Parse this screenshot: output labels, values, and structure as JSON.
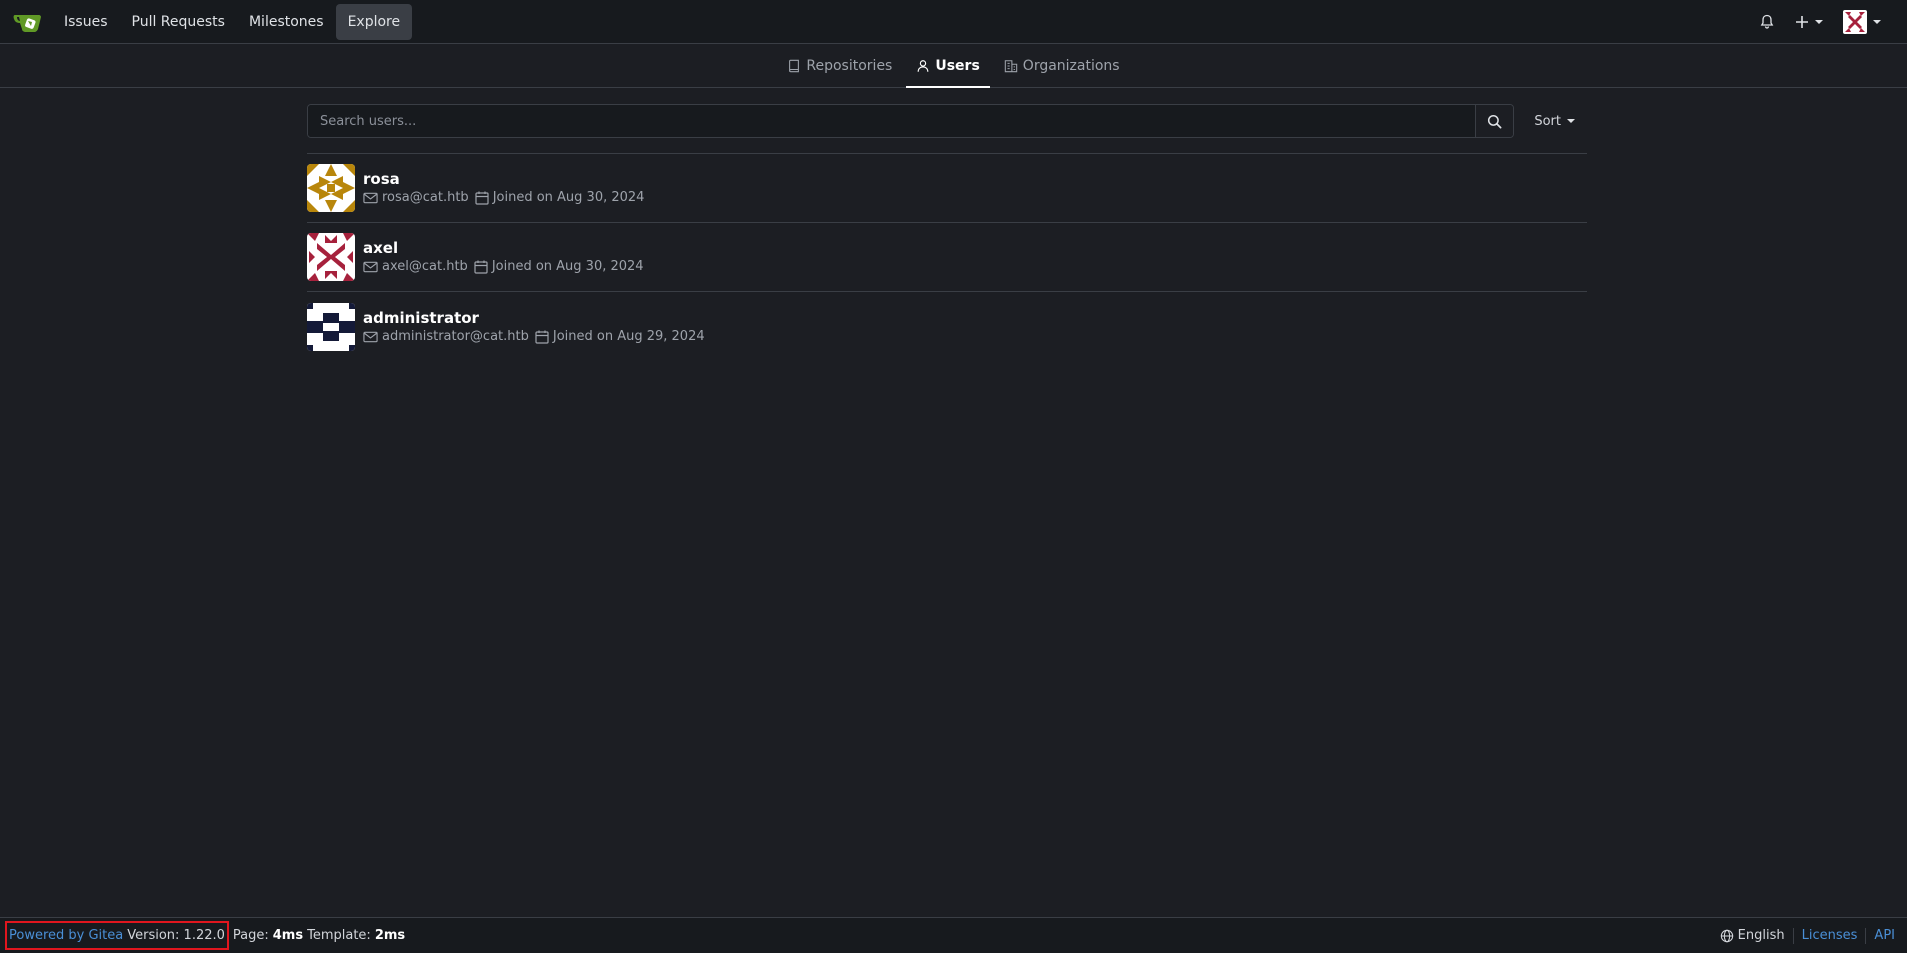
{
  "nav": {
    "items": [
      {
        "label": "Issues"
      },
      {
        "label": "Pull Requests"
      },
      {
        "label": "Milestones"
      },
      {
        "label": "Explore",
        "active": true
      }
    ],
    "icons": [
      "bell-icon",
      "plus-icon",
      "avatar"
    ]
  },
  "tabs": [
    {
      "label": "Repositories",
      "icon": "repo-icon"
    },
    {
      "label": "Users",
      "icon": "person-icon",
      "active": true
    },
    {
      "label": "Organizations",
      "icon": "organization-icon"
    }
  ],
  "search": {
    "placeholder": "Search users...",
    "sort_label": "Sort"
  },
  "users": [
    {
      "name": "rosa",
      "email": "rosa@cat.htb",
      "joined": "Joined on Aug 30, 2024"
    },
    {
      "name": "axel",
      "email": "axel@cat.htb",
      "joined": "Joined on Aug 30, 2024"
    },
    {
      "name": "administrator",
      "email": "administrator@cat.htb",
      "joined": "Joined on Aug 29, 2024"
    }
  ],
  "footer": {
    "powered_by": "Powered by Gitea",
    "version": "Version: 1.22.0",
    "page_label": "Page:",
    "page_time": "4ms",
    "template_label": "Template:",
    "template_time": "2ms",
    "language": "English",
    "licenses": "Licenses",
    "api": "API"
  },
  "colors": {
    "background": "#1c1e23",
    "navbar": "#171a1e",
    "accent_link": "#4a8fd6",
    "highlight_box": "#e0161e",
    "logo_green": "#609926"
  }
}
